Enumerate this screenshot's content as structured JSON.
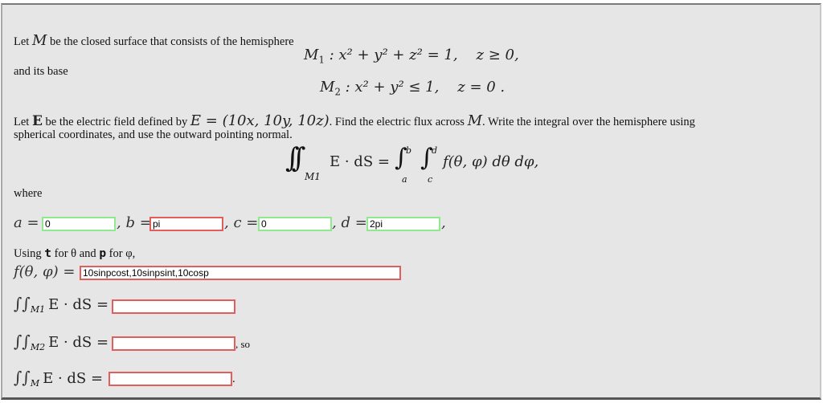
{
  "problem": {
    "intro_prefix": "Let ",
    "intro_var": "M",
    "intro_suffix": " be the closed surface that consists of the hemisphere",
    "eq_m1": {
      "name": "M",
      "sub": "1",
      "body": " : x² + y² + z² = 1,",
      "cond": "z ≥ 0,"
    },
    "base_label": "and its base",
    "eq_m2": {
      "name": "M",
      "sub": "2",
      "body": " : x² + y² ≤ 1,",
      "cond": "z = 0 ."
    },
    "field_prefix": "Let ",
    "field_var": "E",
    "field_mid": " be the electric field defined by ",
    "field_def": "E = (10x, 10y, 10z)",
    "field_suffix": ". Find the electric flux across ",
    "field_suffix_var": "M",
    "field_suffix2": ". Write the integral over the hemisphere using",
    "line2": "spherical coordinates, and use the outward pointing normal.",
    "integral": {
      "lhs_sub": "M1",
      "lhs_body": "E · dS =",
      "limit_a": "a",
      "limit_b": "b",
      "limit_c": "c",
      "limit_d": "d",
      "integrand": "f(θ, φ) dθ dφ,"
    },
    "where_label": "where"
  },
  "limits": {
    "a": {
      "label": "a =",
      "value": "0",
      "status": "correct"
    },
    "b": {
      "label": ", b =",
      "value": "pi",
      "status": "incorrect"
    },
    "c": {
      "label": ", c =",
      "value": "0",
      "status": "correct"
    },
    "d": {
      "label": ", d =",
      "value": "2pi",
      "status": "correct"
    },
    "trailing": ","
  },
  "integrand": {
    "hint_using": "Using ",
    "hint_t": "t",
    "hint_for_theta": " for θ and ",
    "hint_p": "p",
    "hint_for_phi": " for φ,",
    "label": "f(θ, φ) =",
    "value": "10sinpcost,10sinpsint,10cosp",
    "status": "incorrect"
  },
  "fluxes": [
    {
      "sub": "M1",
      "label": "E · dS =",
      "value": "",
      "status": "incorrect",
      "suffix": ""
    },
    {
      "sub": "M2",
      "label": "E · dS =",
      "value": "",
      "status": "incorrect",
      "suffix": ", so"
    },
    {
      "sub": "M",
      "label": "E · dS =",
      "value": "",
      "status": "incorrect",
      "suffix": "."
    }
  ],
  "colors": {
    "correct": "#8fea8f",
    "incorrect": "#e35d5d",
    "panel": "#e6e6e6"
  }
}
